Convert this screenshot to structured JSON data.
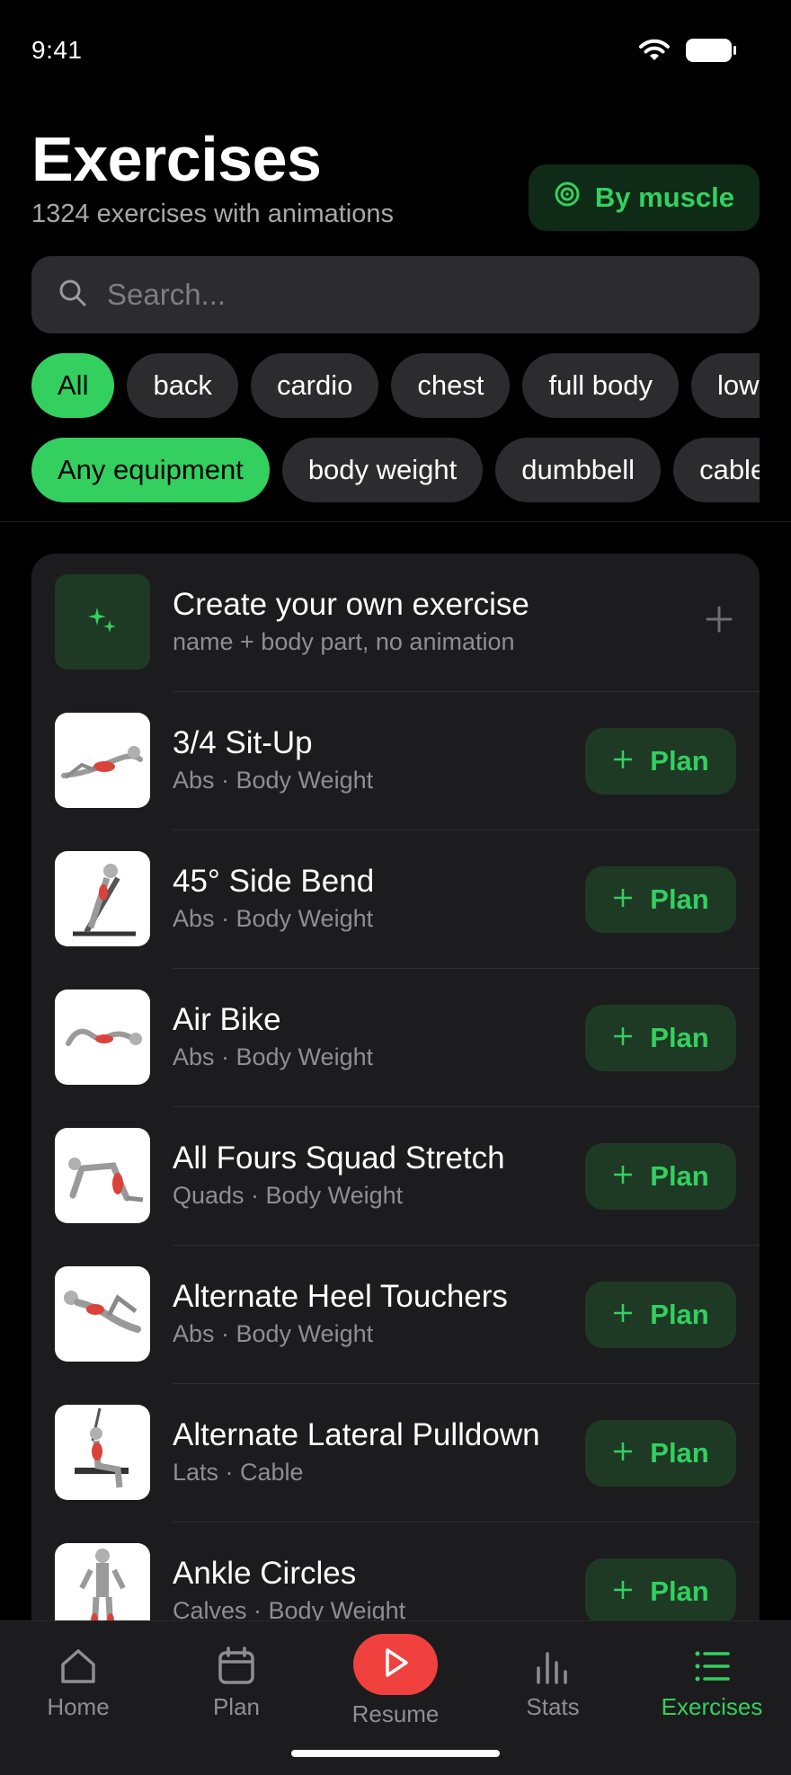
{
  "status": {
    "time": "9:41"
  },
  "header": {
    "title": "Exercises",
    "subtitle": "1324 exercises with animations",
    "by_muscle_label": "By muscle"
  },
  "search": {
    "placeholder": "Search..."
  },
  "body_part_chips": [
    {
      "label": "All",
      "active": true
    },
    {
      "label": "back",
      "active": false
    },
    {
      "label": "cardio",
      "active": false
    },
    {
      "label": "chest",
      "active": false
    },
    {
      "label": "full body",
      "active": false
    },
    {
      "label": "lower legs",
      "active": false
    }
  ],
  "equipment_chips": [
    {
      "label": "Any equipment",
      "active": true
    },
    {
      "label": "body weight",
      "active": false
    },
    {
      "label": "dumbbell",
      "active": false
    },
    {
      "label": "cable",
      "active": false
    }
  ],
  "create": {
    "title": "Create your own exercise",
    "subtitle": "name + body part, no animation"
  },
  "plan_label": "Plan",
  "exercises": [
    {
      "name": "3/4 Sit-Up",
      "meta": "Abs · Body Weight"
    },
    {
      "name": "45° Side Bend",
      "meta": "Abs · Body Weight"
    },
    {
      "name": "Air Bike",
      "meta": "Abs · Body Weight"
    },
    {
      "name": "All Fours Squad Stretch",
      "meta": "Quads · Body Weight"
    },
    {
      "name": "Alternate Heel Touchers",
      "meta": "Abs · Body Weight"
    },
    {
      "name": "Alternate Lateral Pulldown",
      "meta": "Lats · Cable"
    },
    {
      "name": "Ankle Circles",
      "meta": "Calves · Body Weight"
    }
  ],
  "tabs": {
    "home": "Home",
    "plan": "Plan",
    "resume": "Resume",
    "stats": "Stats",
    "exercises": "Exercises"
  },
  "colors": {
    "accent": "#33d060",
    "resume": "#f0413e",
    "background": "#000000",
    "card": "#1c1c1e"
  }
}
